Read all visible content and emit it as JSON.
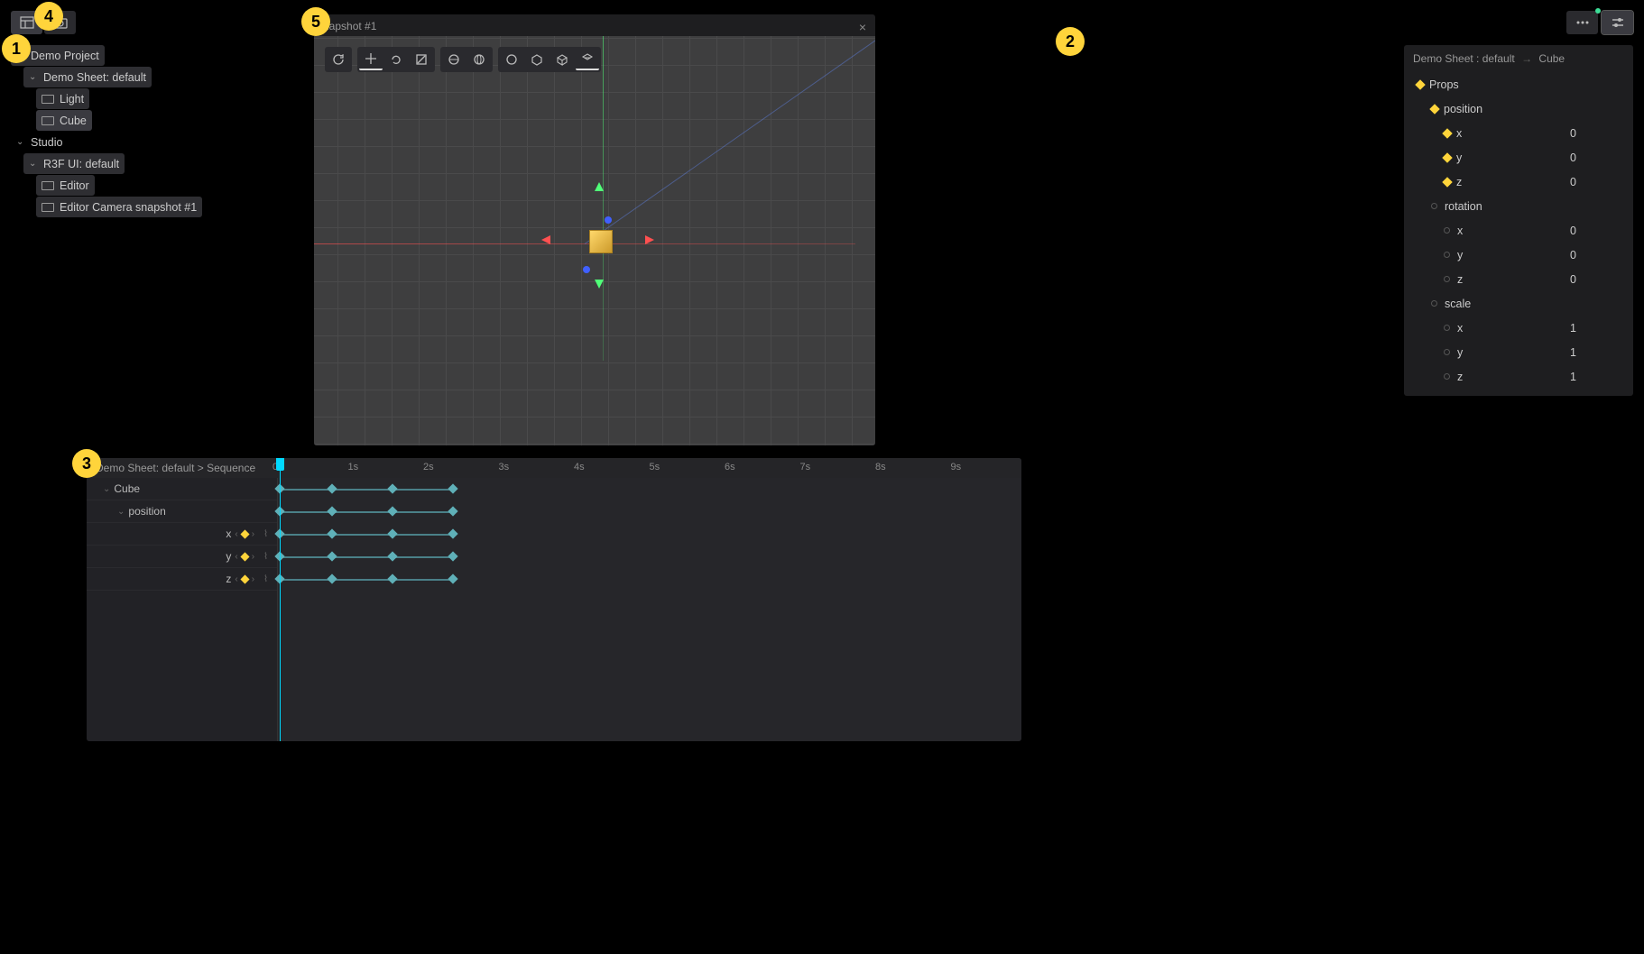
{
  "top_toolbar": {
    "layout_icon": "layout-icon",
    "camera_icon": "camera-icon"
  },
  "top_right": {
    "more_icon": "more-horizontal-icon",
    "sliders_icon": "sliders-icon"
  },
  "outline": {
    "project": "Demo Project",
    "sheet": "Demo Sheet: default",
    "light": "Light",
    "cube": "Cube",
    "studio": "Studio",
    "r3f": "R3F UI: default",
    "editor": "Editor",
    "snapshot": "Editor Camera snapshot #1"
  },
  "viewport": {
    "title": "napshot #1",
    "close": "×"
  },
  "props": {
    "breadcrumb_sheet": "Demo Sheet : default",
    "breadcrumb_arrow": "→",
    "breadcrumb_obj": "Cube",
    "header": "Props",
    "position_label": "position",
    "rotation_label": "rotation",
    "scale_label": "scale",
    "x": "x",
    "y": "y",
    "z": "z",
    "pos_x": "0",
    "pos_y": "0",
    "pos_z": "0",
    "rot_x": "0",
    "rot_y": "0",
    "rot_z": "0",
    "scl_x": "1",
    "scl_y": "1",
    "scl_z": "1"
  },
  "timeline": {
    "breadcrumb": "Demo Sheet: default > Sequence",
    "ticks": [
      "0s",
      "1s",
      "2s",
      "3s",
      "4s",
      "5s",
      "6s",
      "7s",
      "8s",
      "9s"
    ],
    "tracks": {
      "cube": "Cube",
      "position": "position",
      "x": "x",
      "y": "y",
      "z": "z"
    },
    "keyframe_times": [
      0,
      0.7,
      1.5,
      2.3
    ]
  },
  "badges": {
    "b1": "1",
    "b2": "2",
    "b3": "3",
    "b4": "4",
    "b5": "5"
  }
}
